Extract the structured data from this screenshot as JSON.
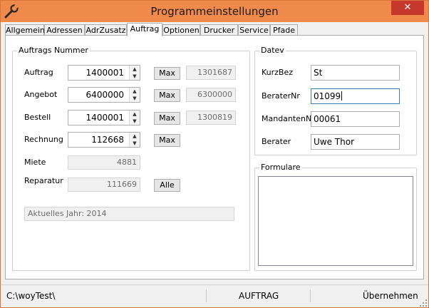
{
  "window": {
    "title": "Programmeinstellungen",
    "close": "✕",
    "accent": "#f08a4b"
  },
  "tabs": [
    "Allgemein",
    "Adressen",
    "AdrZusatz",
    "Auftrag",
    "Optionen",
    "Drucker",
    "Service",
    "Pfade"
  ],
  "active_tab": "Auftrag",
  "auftrags": {
    "legend": "Auftrags Nummer",
    "rows": [
      {
        "label": "Auftrag",
        "value": "1400001",
        "button": "Max",
        "readonly": "1301687"
      },
      {
        "label": "Angebot",
        "value": "6400000",
        "button": "Max",
        "readonly": "6300000"
      },
      {
        "label": "Bestell",
        "value": "1400001",
        "button": "Max",
        "readonly": "1300819"
      },
      {
        "label": "Rechnung",
        "value": "112668",
        "button": "Max"
      }
    ],
    "miete": {
      "label": "Miete",
      "value": "4881"
    },
    "reparatur": {
      "label": "Reparatur",
      "value": "111669",
      "button": "Alle"
    },
    "jahr": "Aktuelles Jahr: 2014"
  },
  "datev": {
    "legend": "Datev",
    "fields": [
      {
        "label": "KurzBez",
        "value": "St"
      },
      {
        "label": "BeraterNr",
        "value": "01099"
      },
      {
        "label": "MandantenNr",
        "value": "00061"
      },
      {
        "label": "Berater",
        "value": "Uwe Thor"
      }
    ]
  },
  "formulare": {
    "legend": "Formulare"
  },
  "status": {
    "path": "C:\\woyTest\\",
    "mode": "AUFTRAG",
    "apply": "Übernehmen"
  }
}
